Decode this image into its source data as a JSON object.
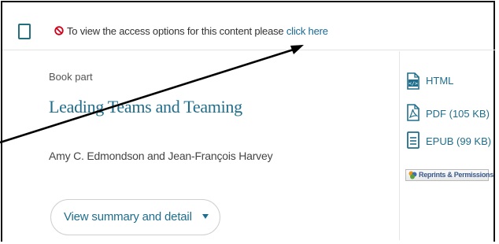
{
  "access": {
    "text": "To view the access options for this content please",
    "link_label": "click here"
  },
  "item": {
    "type_label": "Book part",
    "title": "Leading Teams and Teaming",
    "authors": "Amy C. Edmondson and Jean-François Harvey",
    "summary_button_label": "View summary and detail"
  },
  "formats": [
    {
      "label": "HTML",
      "icon": "html-file-icon"
    },
    {
      "label": "PDF (105 KB)",
      "icon": "pdf-file-icon"
    },
    {
      "label": "EPUB (99 KB)",
      "icon": "epub-file-icon"
    }
  ],
  "reprints": {
    "label": "Reprints & Permissions"
  },
  "colors": {
    "accent": "#1f6e8c",
    "link": "#1a6a94",
    "blocked": "#d0021b",
    "annotation_arrow": "#000000"
  }
}
